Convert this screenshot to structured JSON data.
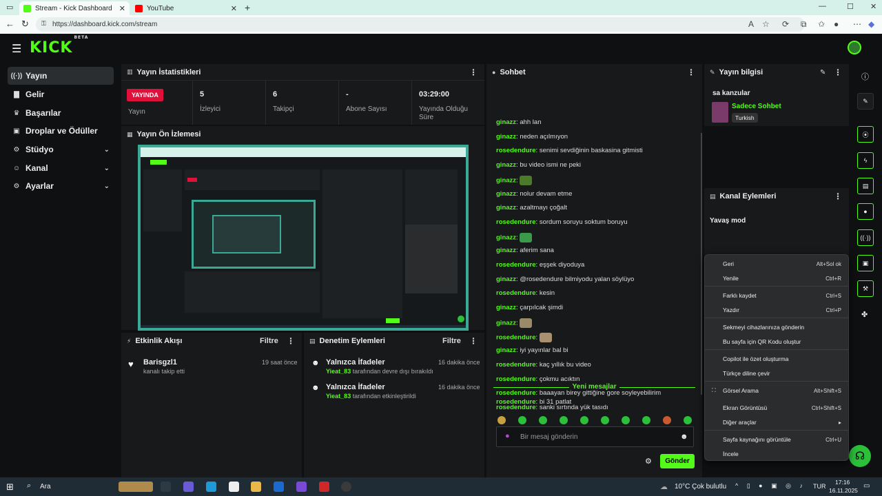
{
  "browser": {
    "tabs": [
      {
        "title": "Stream - Kick Dashboard",
        "fav_color": "#53fc18",
        "active": true
      },
      {
        "title": "YouTube",
        "fav_color": "#ff0000",
        "active": false
      }
    ],
    "url": "https://dashboard.kick.com/stream"
  },
  "header": {
    "logo": "KICK",
    "logo_badge": "BETA"
  },
  "sidebar": {
    "items": [
      {
        "label": "Yayın",
        "icon": "broadcast-icon",
        "glyph": "((·))"
      },
      {
        "label": "Gelir",
        "icon": "chart-icon",
        "glyph": "▇"
      },
      {
        "label": "Başarılar",
        "icon": "trophy-icon",
        "glyph": "🏆"
      },
      {
        "label": "Droplar ve Ödüller",
        "icon": "gift-icon",
        "glyph": "▣"
      },
      {
        "label": "Stüdyo",
        "icon": "gear-icon",
        "glyph": "⚙"
      },
      {
        "label": "Kanal",
        "icon": "user-icon",
        "glyph": "👤"
      },
      {
        "label": "Ayarlar",
        "icon": "settings-icon",
        "glyph": "⚙"
      }
    ]
  },
  "stats_panel": {
    "title": "Yayın İstatistikleri",
    "live_badge": "YAYINDA",
    "live_label": "Yayın",
    "stats": [
      {
        "value": "5",
        "label": "İzleyici"
      },
      {
        "value": "6",
        "label": "Takipçi"
      },
      {
        "value": "-",
        "label": "Abone Sayısı"
      },
      {
        "value": "03:29:00",
        "label": "Yayında Olduğu Süre"
      }
    ]
  },
  "preview_panel": {
    "title": "Yayın Ön İzlemesi"
  },
  "activity_panel": {
    "title": "Etkinlik Akışı",
    "filter": "Filtre",
    "items": [
      {
        "name": "Barisgzl1",
        "text": "kanalı takip etti",
        "time": "19 saat önce"
      }
    ]
  },
  "moderation_panel": {
    "title": "Denetim Eylemleri",
    "filter": "Filtre",
    "items": [
      {
        "title": "Yalnızca İfadeler",
        "user": "Yieat_83",
        "text": " tarafından devre dışı bırakıldı",
        "time": "16 dakika önce"
      },
      {
        "title": "Yalnızca İfadeler",
        "user": "Yieat_83",
        "text": " tarafından etkinleştirildi",
        "time": "16 dakika önce"
      }
    ]
  },
  "chat": {
    "title": "Sohbet",
    "messages": [
      {
        "user": "ginazz",
        "text": "ahh lan",
        "emote": ""
      },
      {
        "user": "ginazz",
        "text": "neden açılmıyon",
        "emote": ""
      },
      {
        "user": "rosedendure",
        "text": "senimi sevdiğinin baskasina gitmisti",
        "emote": ""
      },
      {
        "user": "ginazz",
        "text": "bu video ismi ne peki",
        "emote": ""
      },
      {
        "user": "ginazz",
        "text": "",
        "emote": "#4a7a2a"
      },
      {
        "user": "ginazz",
        "text": "nolur devam etme",
        "emote": ""
      },
      {
        "user": "ginazz",
        "text": "azaltmayı çoğalt",
        "emote": ""
      },
      {
        "user": "rosedendure",
        "text": "sordum soruyu soktum boruyu",
        "emote": ""
      },
      {
        "user": "ginazz",
        "text": "",
        "emote": "#3a9a4a"
      },
      {
        "user": "ginazz",
        "text": "aferim sana",
        "emote": ""
      },
      {
        "user": "rosedendure",
        "text": "eşşek diyoduya",
        "emote": ""
      },
      {
        "user": "ginazz",
        "text": "@rosedendure bilmiyodu yalan söylüyo",
        "emote": ""
      },
      {
        "user": "rosedendure",
        "text": "kesin",
        "emote": ""
      },
      {
        "user": "ginazz",
        "text": "çarpılcak şimdi",
        "emote": ""
      },
      {
        "user": "ginazz",
        "text": "",
        "emote": "#9a8a6a"
      },
      {
        "user": "rosedendure",
        "text": "",
        "emote": "#a89070"
      },
      {
        "user": "ginazz",
        "text": "iyi yayınlar bal bi",
        "emote": ""
      },
      {
        "user": "rosedendure",
        "text": "kaç yıllık bu video",
        "emote": ""
      },
      {
        "user": "rosedendure",
        "text": "çokmu acıktın",
        "emote": ""
      },
      {
        "user": "rosedendure",
        "text": "baaayan birey gittiğine gore soyleyebilirim",
        "emote": ""
      },
      {
        "user": "rosedendure",
        "text": "sanki sırtında yük tasıdı",
        "emote": ""
      }
    ],
    "new_messages_label": "Yeni mesajlar",
    "after_new": {
      "user": "rosedendure",
      "text": "bi 31 patlat"
    },
    "input_placeholder": "Bir mesaj gönderin",
    "send_label": "Gönder"
  },
  "stream_info": {
    "title": "Yayın bilgisi",
    "stream_title": "sa kanzular",
    "category": "Sadece Sohbet",
    "language": "Turkish"
  },
  "channel_actions": {
    "title": "Kanal Eylemleri",
    "partial_item": "Yavaş mod"
  },
  "context_menu": {
    "items": [
      {
        "label": "Geri",
        "shortcut": "Alt+Sol ok"
      },
      {
        "label": "Yenile",
        "shortcut": "Ctrl+R"
      },
      {
        "label": "Farklı kaydet",
        "shortcut": "Ctrl+S"
      },
      {
        "label": "Yazdır",
        "shortcut": "Ctrl+P"
      },
      {
        "label": "Sekmeyi cihazlarınıza gönderin",
        "shortcut": ""
      },
      {
        "label": "Bu sayfa için QR Kodu oluştur",
        "shortcut": ""
      },
      {
        "label": "Copilot ile özet oluşturma",
        "shortcut": ""
      },
      {
        "label": "Türkçe diline çevir",
        "shortcut": ""
      },
      {
        "label": "Görsel Arama",
        "shortcut": "Alt+Shift+S"
      },
      {
        "label": "Ekran Görüntüsü",
        "shortcut": "Ctrl+Shift+S"
      },
      {
        "label": "Diğer araçlar",
        "shortcut": "▸"
      },
      {
        "label": "Sayfa kaynağını görüntüle",
        "shortcut": "Ctrl+U"
      },
      {
        "label": "İncele",
        "shortcut": ""
      }
    ]
  },
  "taskbar": {
    "search": "Ara",
    "weather": "10°C  Çok bulutlu",
    "lang": "TUR",
    "time": "17:16",
    "date": "16.11.2025"
  },
  "colors": {
    "accent": "#53fc18",
    "live": "#e0103a",
    "panel": "#17191b"
  }
}
